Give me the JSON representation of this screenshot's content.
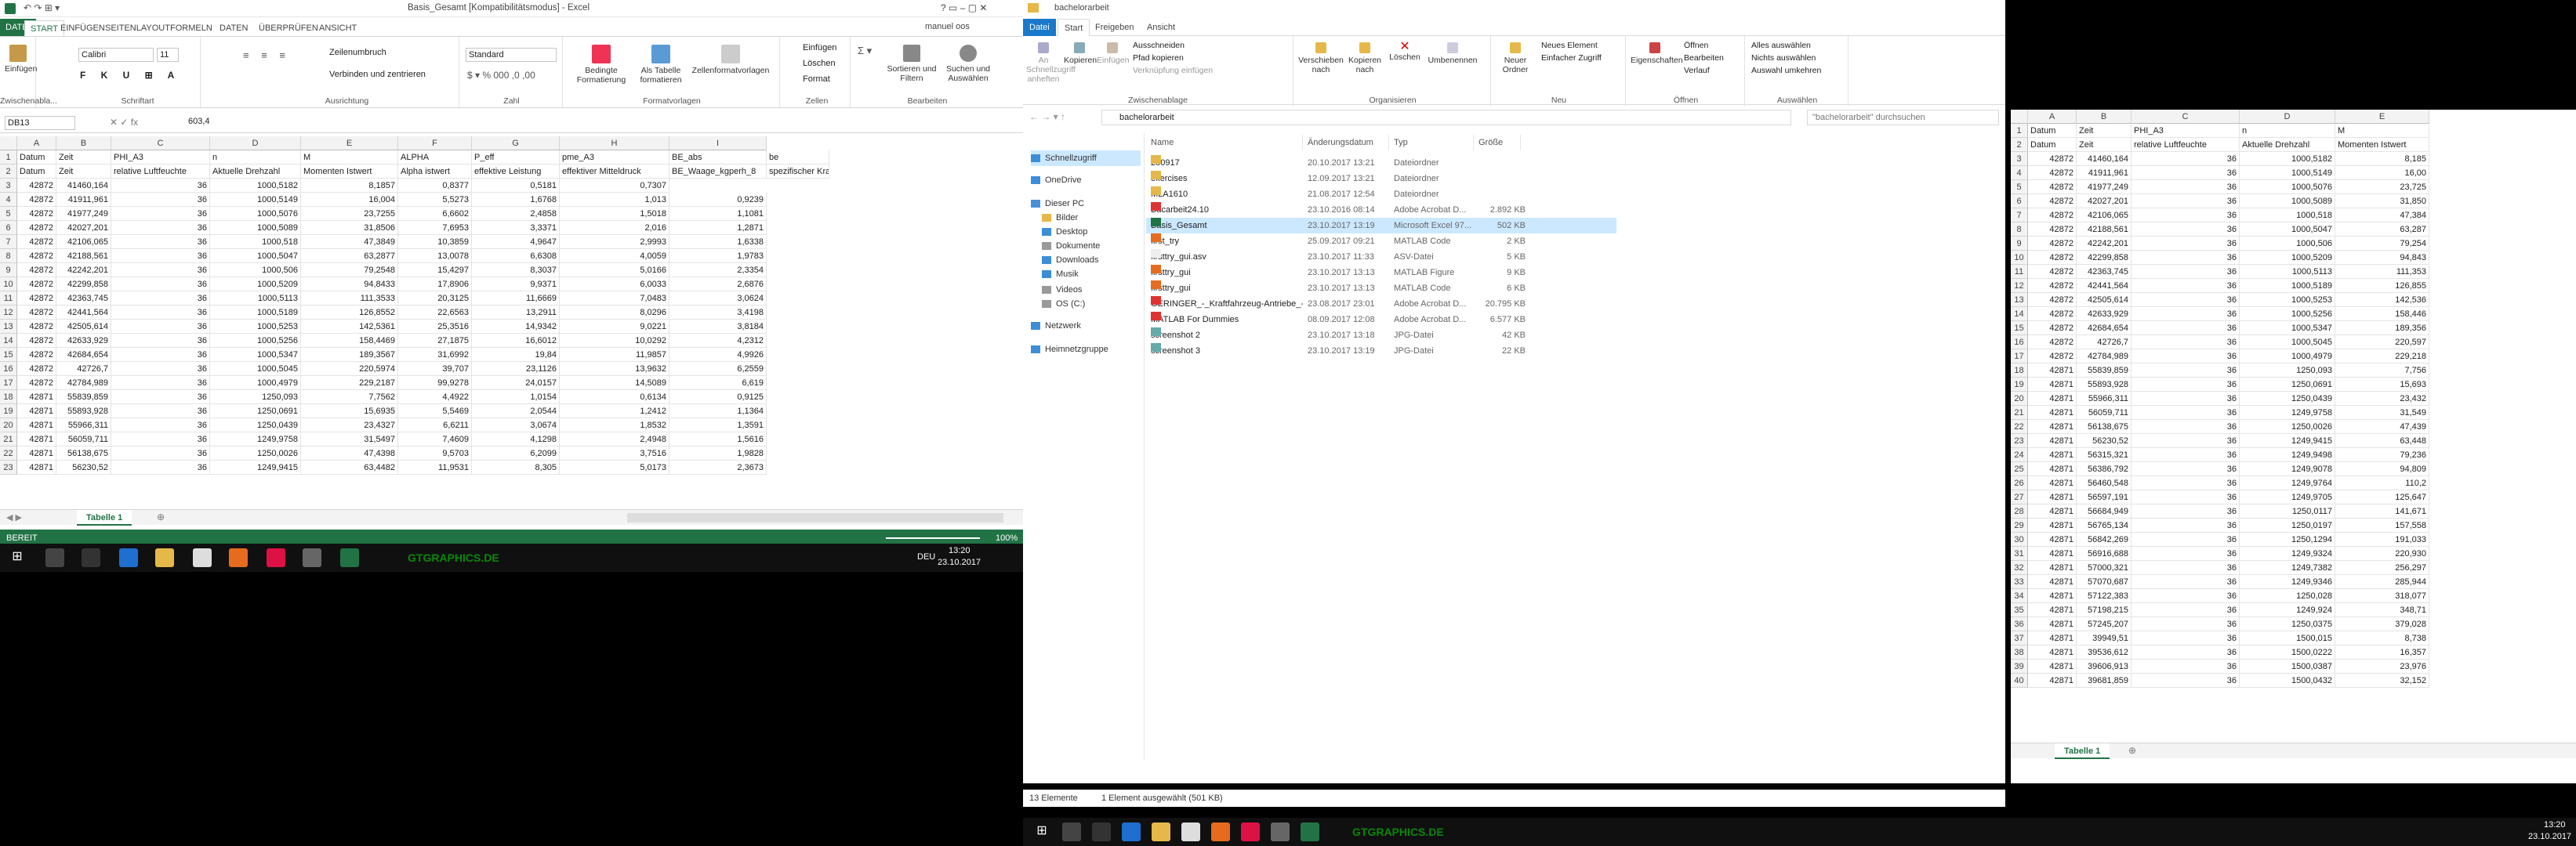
{
  "excel1": {
    "title": "Basis_Gesamt  [Kompatibilitätsmodus] - Excel",
    "user": "manuel oos",
    "tabs": [
      "DATEI",
      "START",
      "EINFÜGEN",
      "SEITENLAYOUT",
      "FORMELN",
      "DATEN",
      "ÜBERPRÜFEN",
      "ANSICHT"
    ],
    "ribbon": {
      "paste": "Einfügen",
      "clipboard": "Zwischenabla...",
      "font_name": "Calibri",
      "font_size": "11",
      "font_group": "Schriftart",
      "wrap": "Zeilenumbruch",
      "merge": "Verbinden und zentrieren",
      "align_group": "Ausrichtung",
      "number_format": "Standard",
      "number_group": "Zahl",
      "cond_fmt": "Bedingte Formatierung",
      "as_table": "Als Tabelle formatieren",
      "cell_styles": "Zellenformatvorlagen",
      "styles_group": "Formatvorlagen",
      "insert": "Einfügen",
      "delete": "Löschen",
      "format": "Format",
      "cells_group": "Zellen",
      "sort": "Sortieren und Filtern",
      "find": "Suchen und Auswählen",
      "edit_group": "Bearbeiten"
    },
    "namebox": "DB13",
    "formula": "603,4",
    "columns": [
      "A",
      "B",
      "C",
      "D",
      "E",
      "F",
      "G",
      "H",
      "I"
    ],
    "header1": [
      "Datum",
      "Zeit",
      "PHI_A3",
      "n",
      "M",
      "ALPHA",
      "P_eff",
      "pme_A3",
      "BE_abs",
      "be"
    ],
    "header2": [
      "Datum",
      "Zeit",
      "relative Luftfeuchte",
      "Aktuelle Drehzahl",
      "Momenten Istwert",
      "Alpha istwert",
      "effektive Leistung",
      "effektiver Mitteldruck",
      "BE_Waage_kgperh_8",
      "spezifischer Kraft"
    ],
    "rows": [
      [
        "42872",
        "41460,164",
        "36",
        "1000,5182",
        "8,1857",
        "0,8377",
        "0,5181",
        "0,7307"
      ],
      [
        "42872",
        "41911,961",
        "36",
        "1000,5149",
        "16,004",
        "5,5273",
        "1,6768",
        "1,013",
        "0,9239"
      ],
      [
        "42872",
        "41977,249",
        "36",
        "1000,5076",
        "23,7255",
        "6,6602",
        "2,4858",
        "1,5018",
        "1,1081"
      ],
      [
        "42872",
        "42027,201",
        "36",
        "1000,5089",
        "31,8506",
        "7,6953",
        "3,3371",
        "2,016",
        "1,2871"
      ],
      [
        "42872",
        "42106,065",
        "36",
        "1000,518",
        "47,3849",
        "10,3859",
        "4,9647",
        "2,9993",
        "1,6338"
      ],
      [
        "42872",
        "42188,561",
        "36",
        "1000,5047",
        "63,2877",
        "13,0078",
        "6,6308",
        "4,0059",
        "1,9783"
      ],
      [
        "42872",
        "42242,201",
        "36",
        "1000,506",
        "79,2548",
        "15,4297",
        "8,3037",
        "5,0166",
        "2,3354"
      ],
      [
        "42872",
        "42299,858",
        "36",
        "1000,5209",
        "94,8433",
        "17,8906",
        "9,9371",
        "6,0033",
        "2,6876"
      ],
      [
        "42872",
        "42363,745",
        "36",
        "1000,5113",
        "111,3533",
        "20,3125",
        "11,6669",
        "7,0483",
        "3,0624"
      ],
      [
        "42872",
        "42441,564",
        "36",
        "1000,5189",
        "126,8552",
        "22,6563",
        "13,2911",
        "8,0296",
        "3,4198"
      ],
      [
        "42872",
        "42505,614",
        "36",
        "1000,5253",
        "142,5361",
        "25,3516",
        "14,9342",
        "9,0221",
        "3,8184"
      ],
      [
        "42872",
        "42633,929",
        "36",
        "1000,5256",
        "158,4469",
        "27,1875",
        "16,6012",
        "10,0292",
        "4,2312"
      ],
      [
        "42872",
        "42684,654",
        "36",
        "1000,5347",
        "189,3567",
        "31,6992",
        "19,84",
        "11,9857",
        "4,9926"
      ],
      [
        "42872",
        "42726,7",
        "36",
        "1000,5045",
        "220,5974",
        "39,707",
        "23,1126",
        "13,9632",
        "6,2559"
      ],
      [
        "42872",
        "42784,989",
        "36",
        "1000,4979",
        "229,2187",
        "99,9278",
        "24,0157",
        "14,5089",
        "6,619"
      ],
      [
        "42871",
        "55839,859",
        "36",
        "1250,093",
        "7,7562",
        "4,4922",
        "1,0154",
        "0,6134",
        "0,9125"
      ],
      [
        "42871",
        "55893,928",
        "36",
        "1250,0691",
        "15,6935",
        "5,5469",
        "2,0544",
        "1,2412",
        "1,1364"
      ],
      [
        "42871",
        "55966,311",
        "36",
        "1250,0439",
        "23,4327",
        "6,6211",
        "3,0674",
        "1,8532",
        "1,3591"
      ],
      [
        "42871",
        "56059,711",
        "36",
        "1249,9758",
        "31,5497",
        "7,4609",
        "4,1298",
        "2,4948",
        "1,5616"
      ],
      [
        "42871",
        "56138,675",
        "36",
        "1250,0026",
        "47,4398",
        "9,5703",
        "6,2099",
        "3,7516",
        "1,9828"
      ],
      [
        "42871",
        "56230,52",
        "36",
        "1249,9415",
        "63,4482",
        "11,9531",
        "8,305",
        "5,0173",
        "2,3673"
      ]
    ],
    "sheet_tab": "Tabelle 1",
    "status": "BEREIT",
    "zoom": "100%"
  },
  "taskbar1": {
    "time": "13:20",
    "date": "23.10.2017",
    "lang": "DEU",
    "watermark": "GTGRAPHICS.DE"
  },
  "explorer": {
    "title": "bachelorarbeit",
    "tabs": [
      "Datei",
      "Start",
      "Freigeben",
      "Ansicht"
    ],
    "ribbon": {
      "quick": "An Schnellzugriff anheften",
      "copy": "Kopieren",
      "paste": "Einfügen",
      "cut": "Ausschneiden",
      "copy_path": "Pfad kopieren",
      "paste_link": "Verknüpfung einfügen",
      "clip_group": "Zwischenablage",
      "move": "Verschieben nach",
      "copyto": "Kopieren nach",
      "delete": "Löschen",
      "rename": "Umbenennen",
      "org_group": "Organisieren",
      "newfolder": "Neuer Ordner",
      "newitem": "Neues Element",
      "easyaccess": "Einfacher Zugriff",
      "new_group": "Neu",
      "props": "Eigenschaften",
      "open": "Öffnen",
      "edit": "Bearbeiten",
      "history": "Verlauf",
      "open_group": "Öffnen",
      "selall": "Alles auswählen",
      "selnone": "Nichts auswählen",
      "selinv": "Auswahl umkehren",
      "sel_group": "Auswählen"
    },
    "path": "bachelorarbeit",
    "search": "\"bachelorarbeit\" durchsuchen",
    "nav": [
      "Schnellzugriff",
      "OneDrive",
      "Dieser PC",
      "Bilder",
      "Desktop",
      "Dokumente",
      "Downloads",
      "Musik",
      "Videos",
      "OS (C:)",
      "Netzwerk",
      "Heimnetzgruppe"
    ],
    "headers": [
      "Name",
      "Änderungsdatum",
      "Typ",
      "Größe"
    ],
    "files": [
      [
        "250917",
        "20.10.2017 13:21",
        "Dateiordner",
        ""
      ],
      [
        "exercises",
        "12.09.2017 13:21",
        "Dateiordner",
        ""
      ],
      [
        "MLA1610",
        "21.08.2017 12:54",
        "Dateiordner",
        ""
      ],
      [
        "Bacarbeit24.10",
        "23.10.2016 08:14",
        "Adobe Acrobat D...",
        "2.892 KB"
      ],
      [
        "Basis_Gesamt",
        "23.10.2017 13:19",
        "Microsoft Excel 97...",
        "502 KB"
      ],
      [
        "first_try",
        "25.09.2017 09:21",
        "MATLAB Code",
        "2 KB"
      ],
      [
        "firsttry_gui.asv",
        "23.10.2017 11:33",
        "ASV-Datei",
        "5 KB"
      ],
      [
        "firsttry_gui",
        "23.10.2017 13:13",
        "MATLAB Figure",
        "9 KB"
      ],
      [
        "firsttry_gui",
        "23.10.2017 13:13",
        "MATLAB Code",
        "6 KB"
      ],
      [
        "GERINGER_-_Kraftfahrzeug-Antriebe_-_ak...",
        "23.08.2017 23:01",
        "Adobe Acrobat D...",
        "20.795 KB"
      ],
      [
        "MATLAB For Dummies",
        "08.09.2017 12:08",
        "Adobe Acrobat D...",
        "6.577 KB"
      ],
      [
        "screenshot 2",
        "23.10.2017 13:18",
        "JPG-Datei",
        "42 KB"
      ],
      [
        "screenshot 3",
        "23.10.2017 13:19",
        "JPG-Datei",
        "22 KB"
      ]
    ],
    "status_count": "13 Elemente",
    "status_sel": "1 Element ausgewählt (501 KB)"
  },
  "excel2": {
    "columns": [
      "A",
      "B",
      "C",
      "D",
      "E"
    ],
    "header1": [
      "Datum",
      "Zeit",
      "PHI_A3",
      "n",
      "M"
    ],
    "header2": [
      "Datum",
      "Zeit",
      "relative Luftfeuchte",
      "Aktuelle Drehzahl",
      "Momenten Istwert"
    ],
    "rows": [
      [
        "42872",
        "41460,164",
        "36",
        "1000,5182",
        "8,185"
      ],
      [
        "42872",
        "41911,961",
        "36",
        "1000,5149",
        "16,00"
      ],
      [
        "42872",
        "41977,249",
        "36",
        "1000,5076",
        "23,725"
      ],
      [
        "42872",
        "42027,201",
        "36",
        "1000,5089",
        "31,850"
      ],
      [
        "42872",
        "42106,065",
        "36",
        "1000,518",
        "47,384"
      ],
      [
        "42872",
        "42188,561",
        "36",
        "1000,5047",
        "63,287"
      ],
      [
        "42872",
        "42242,201",
        "36",
        "1000,506",
        "79,254"
      ],
      [
        "42872",
        "42299,858",
        "36",
        "1000,5209",
        "94,843"
      ],
      [
        "42872",
        "42363,745",
        "36",
        "1000,5113",
        "111,353"
      ],
      [
        "42872",
        "42441,564",
        "36",
        "1000,5189",
        "126,855"
      ],
      [
        "42872",
        "42505,614",
        "36",
        "1000,5253",
        "142,536"
      ],
      [
        "42872",
        "42633,929",
        "36",
        "1000,5256",
        "158,446"
      ],
      [
        "42872",
        "42684,654",
        "36",
        "1000,5347",
        "189,356"
      ],
      [
        "42872",
        "42726,7",
        "36",
        "1000,5045",
        "220,597"
      ],
      [
        "42872",
        "42784,989",
        "36",
        "1000,4979",
        "229,218"
      ],
      [
        "42871",
        "55839,859",
        "36",
        "1250,093",
        "7,756"
      ],
      [
        "42871",
        "55893,928",
        "36",
        "1250,0691",
        "15,693"
      ],
      [
        "42871",
        "55966,311",
        "36",
        "1250,0439",
        "23,432"
      ],
      [
        "42871",
        "56059,711",
        "36",
        "1249,9758",
        "31,549"
      ],
      [
        "42871",
        "56138,675",
        "36",
        "1250,0026",
        "47,439"
      ],
      [
        "42871",
        "56230,52",
        "36",
        "1249,9415",
        "63,448"
      ],
      [
        "42871",
        "56315,321",
        "36",
        "1249,9498",
        "79,236"
      ],
      [
        "42871",
        "56386,792",
        "36",
        "1249,9078",
        "94,809"
      ],
      [
        "42871",
        "56460,548",
        "36",
        "1249,9764",
        "110,2"
      ],
      [
        "42871",
        "56597,191",
        "36",
        "1249,9705",
        "125,647"
      ],
      [
        "42871",
        "56684,949",
        "36",
        "1250,0117",
        "141,671"
      ],
      [
        "42871",
        "56765,134",
        "36",
        "1250,0197",
        "157,558"
      ],
      [
        "42871",
        "56842,269",
        "36",
        "1250,1294",
        "191,033"
      ],
      [
        "42871",
        "56916,688",
        "36",
        "1249,9324",
        "220,930"
      ],
      [
        "42871",
        "57000,321",
        "36",
        "1249,7382",
        "256,297"
      ],
      [
        "42871",
        "57070,687",
        "36",
        "1249,9346",
        "285,944"
      ],
      [
        "42871",
        "57122,383",
        "36",
        "1250,028",
        "318,077"
      ],
      [
        "42871",
        "57198,215",
        "36",
        "1249,924",
        "348,71"
      ],
      [
        "42871",
        "57245,207",
        "36",
        "1250,0375",
        "379,028"
      ],
      [
        "42871",
        "39949,51",
        "36",
        "1500,015",
        "8,738"
      ],
      [
        "42871",
        "39536,612",
        "36",
        "1500,0222",
        "16,357"
      ],
      [
        "42871",
        "39606,913",
        "36",
        "1500,0387",
        "23,976"
      ],
      [
        "42871",
        "39681,859",
        "36",
        "1500,0432",
        "32,152"
      ]
    ],
    "sheet_tab": "Tabelle 1"
  },
  "taskbar2": {
    "time": "13:20",
    "date": "23.10.2017",
    "watermark": "GTGRAPHICS.DE"
  },
  "colors": {
    "excel_green": "#217346",
    "explorer_blue": "#1979ca",
    "selection": "#cce8ff"
  }
}
